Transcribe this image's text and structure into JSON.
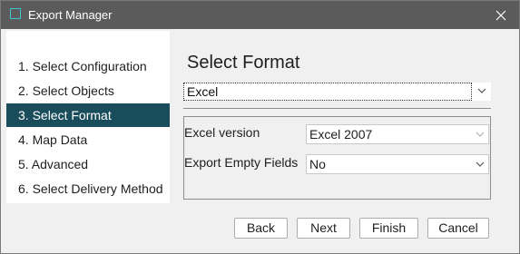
{
  "window": {
    "title": "Export Manager"
  },
  "steps": [
    {
      "label": "1. Select Configuration",
      "active": false
    },
    {
      "label": "2. Select Objects",
      "active": false
    },
    {
      "label": "3. Select Format",
      "active": true
    },
    {
      "label": "4. Map Data",
      "active": false
    },
    {
      "label": "5. Advanced",
      "active": false
    },
    {
      "label": "6. Select Delivery Method",
      "active": false
    }
  ],
  "main": {
    "heading": "Select Format",
    "format_value": "Excel",
    "fields": {
      "excel_version_label": "Excel version",
      "excel_version_value": "Excel 2007",
      "export_empty_label": "Export Empty Fields",
      "export_empty_value": "No"
    }
  },
  "buttons": {
    "back": "Back",
    "next": "Next",
    "finish": "Finish",
    "cancel": "Cancel"
  },
  "colors": {
    "titlebar": "#5b5b5b",
    "active_step": "#1a4d5b",
    "icon_accent": "#3fc3d1"
  }
}
